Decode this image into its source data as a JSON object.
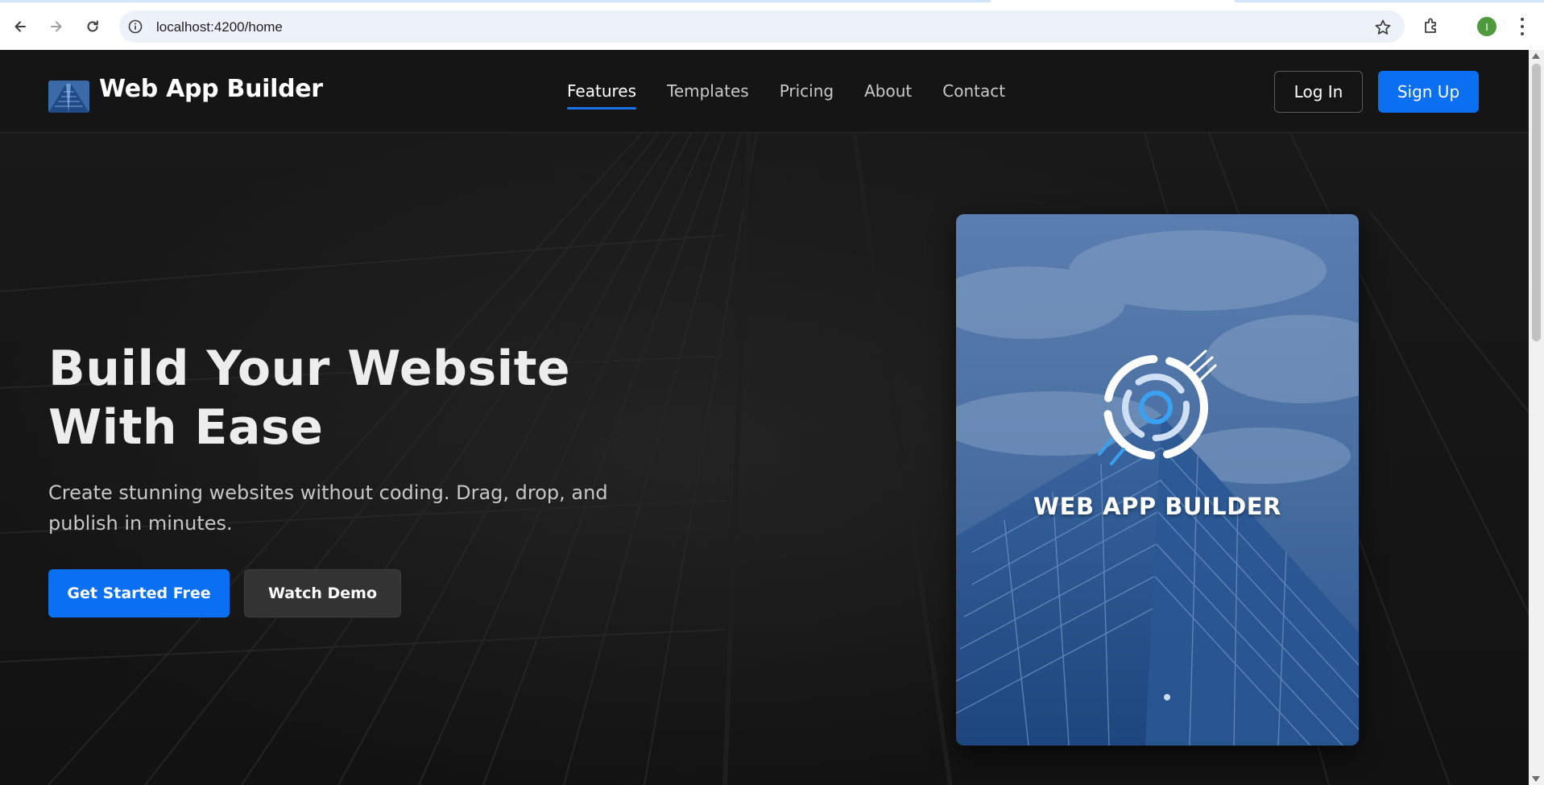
{
  "browser": {
    "url": "localhost:4200/home",
    "profile_initial": "I",
    "icons": {
      "back": "arrow-left-icon",
      "forward": "arrow-right-icon",
      "reload": "reload-icon",
      "site_info": "info-icon",
      "bookmark": "star-icon",
      "extensions": "puzzle-icon",
      "menu": "kebab-menu-icon"
    }
  },
  "navbar": {
    "brand_name": "Web App Builder",
    "links": [
      {
        "label": "Features",
        "active": true
      },
      {
        "label": "Templates",
        "active": false
      },
      {
        "label": "Pricing",
        "active": false
      },
      {
        "label": "About",
        "active": false
      },
      {
        "label": "Contact",
        "active": false
      }
    ],
    "login_label": "Log In",
    "signup_label": "Sign Up"
  },
  "hero": {
    "title": "Build Your Website With Ease",
    "subtitle": "Create stunning websites without coding. Drag, drop, and publish in minutes.",
    "primary_cta": "Get Started Free",
    "secondary_cta": "Watch Demo",
    "card_title": "WEB APP BUILDER"
  },
  "colors": {
    "accent": "#0b6ff1",
    "background": "#151515",
    "card_blue": "#2d5a95"
  }
}
